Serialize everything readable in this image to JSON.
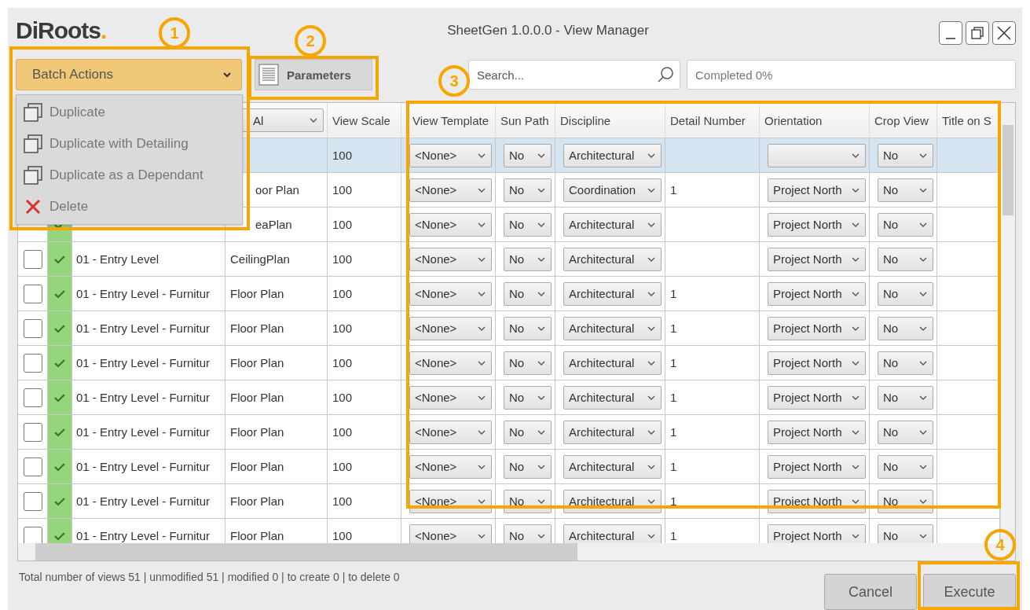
{
  "window": {
    "logo": "DiRoots",
    "logo_dot": ".",
    "title": "SheetGen 1.0.0.0 - View Manager"
  },
  "toolbar": {
    "batch_actions": {
      "label": "Batch Actions",
      "expanded": true,
      "items": [
        {
          "kind": "duplicate",
          "label": "Duplicate"
        },
        {
          "kind": "duplicate",
          "label": "Duplicate with Detailing"
        },
        {
          "kind": "duplicate",
          "label": "Duplicate as a Dependant"
        },
        {
          "kind": "delete",
          "label": "Delete"
        }
      ]
    },
    "parameters_button": "Parameters",
    "search": {
      "placeholder": "Search..."
    },
    "progress": {
      "text": "Completed 0%",
      "level": 0
    }
  },
  "table": {
    "type_filter": "Al",
    "columns": [
      "View Scale",
      "View Template",
      "Sun Path",
      "Discipline",
      "Detail Number",
      "Orientation",
      "Crop View",
      "Title on S"
    ],
    "rows": [
      {
        "selected": true,
        "scale": "100",
        "template": "<None>",
        "sun_path": "No",
        "discipline": "Architectural",
        "detail": "",
        "orientation": "",
        "crop": "No"
      },
      {
        "selected": false,
        "type": "oor Plan",
        "scale": "100",
        "template": "<None>",
        "sun_path": "No",
        "discipline": "Coordination",
        "detail": "1",
        "orientation": "Project North",
        "crop": "No"
      },
      {
        "selected": false,
        "valid": true,
        "type": "eaPlan",
        "scale": "100",
        "template": "<None>",
        "sun_path": "No",
        "discipline": "Architectural",
        "detail": "",
        "orientation": "Project North",
        "crop": "No"
      },
      {
        "selected": false,
        "checked": false,
        "valid": true,
        "name": "01 - Entry Level",
        "type": "CeilingPlan",
        "scale": "100",
        "template": "<None>",
        "sun_path": "No",
        "discipline": "Architectural",
        "detail": "",
        "orientation": "Project North",
        "crop": "No"
      },
      {
        "selected": false,
        "checked": false,
        "valid": true,
        "name": "01 - Entry Level - Furnitur",
        "type": "Floor Plan",
        "scale": "100",
        "template": "<None>",
        "sun_path": "No",
        "discipline": "Architectural",
        "detail": "1",
        "orientation": "Project North",
        "crop": "No"
      },
      {
        "selected": false,
        "checked": false,
        "valid": true,
        "name": "01 - Entry Level - Furnitur",
        "type": "Floor Plan",
        "scale": "100",
        "template": "<None>",
        "sun_path": "No",
        "discipline": "Architectural",
        "detail": "1",
        "orientation": "Project North",
        "crop": "No"
      },
      {
        "selected": false,
        "checked": false,
        "valid": true,
        "name": "01 - Entry Level - Furnitur",
        "type": "Floor Plan",
        "scale": "100",
        "template": "<None>",
        "sun_path": "No",
        "discipline": "Architectural",
        "detail": "1",
        "orientation": "Project North",
        "crop": "No"
      },
      {
        "selected": false,
        "checked": false,
        "valid": true,
        "name": "01 - Entry Level - Furnitur",
        "type": "Floor Plan",
        "scale": "100",
        "template": "<None>",
        "sun_path": "No",
        "discipline": "Architectural",
        "detail": "1",
        "orientation": "Project North",
        "crop": "No"
      },
      {
        "selected": false,
        "checked": false,
        "valid": true,
        "name": "01 - Entry Level - Furnitur",
        "type": "Floor Plan",
        "scale": "100",
        "template": "<None>",
        "sun_path": "No",
        "discipline": "Architectural",
        "detail": "1",
        "orientation": "Project North",
        "crop": "No"
      },
      {
        "selected": false,
        "checked": false,
        "valid": true,
        "name": "01 - Entry Level - Furnitur",
        "type": "Floor Plan",
        "scale": "100",
        "template": "<None>",
        "sun_path": "No",
        "discipline": "Architectural",
        "detail": "1",
        "orientation": "Project North",
        "crop": "No"
      },
      {
        "selected": false,
        "checked": false,
        "valid": true,
        "name": "01 - Entry Level - Furnitur",
        "type": "Floor Plan",
        "scale": "100",
        "template": "<None>",
        "sun_path": "No",
        "discipline": "Architectural",
        "detail": "1",
        "orientation": "Project North",
        "crop": "No"
      },
      {
        "selected": false,
        "checked": false,
        "valid": true,
        "name": "01 - Entry Level - Furnitur",
        "type": "Floor Plan",
        "scale": "100",
        "template": "<None>",
        "sun_path": "No",
        "discipline": "Architectural",
        "detail": "1",
        "orientation": "Project North",
        "crop": "No"
      }
    ]
  },
  "status_bar": "Total number of views 51 | unmodified 51 | modified 0 | to create 0 | to delete 0",
  "buttons": [
    "Cancel",
    "Execute"
  ],
  "annotations": [
    "1",
    "2",
    "3",
    "4"
  ]
}
